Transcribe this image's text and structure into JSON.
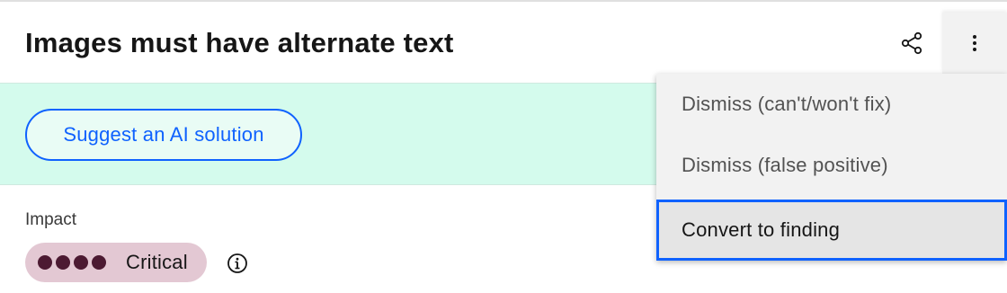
{
  "header": {
    "title": "Images must have alternate text",
    "share_icon": "share-icon",
    "overflow_icon": "overflow-menu-vertical-icon"
  },
  "ai_banner": {
    "button_label": "Suggest an AI solution"
  },
  "impact": {
    "label": "Impact",
    "severity": "Critical",
    "level_filled": 4,
    "level_max": 4,
    "info_icon": "information-icon"
  },
  "overflow_menu": {
    "items": [
      {
        "label": "Dismiss (can't/won't fix)"
      },
      {
        "label": "Dismiss (false positive)"
      },
      {
        "label": "Convert to finding",
        "focused": true
      }
    ]
  },
  "colors": {
    "accent": "#0f62fe",
    "banner_bg": "#d4fbed",
    "critical_tag_bg": "#e3c8d3",
    "critical_dot": "#4c1a32",
    "menu_bg": "#f2f2f2"
  }
}
